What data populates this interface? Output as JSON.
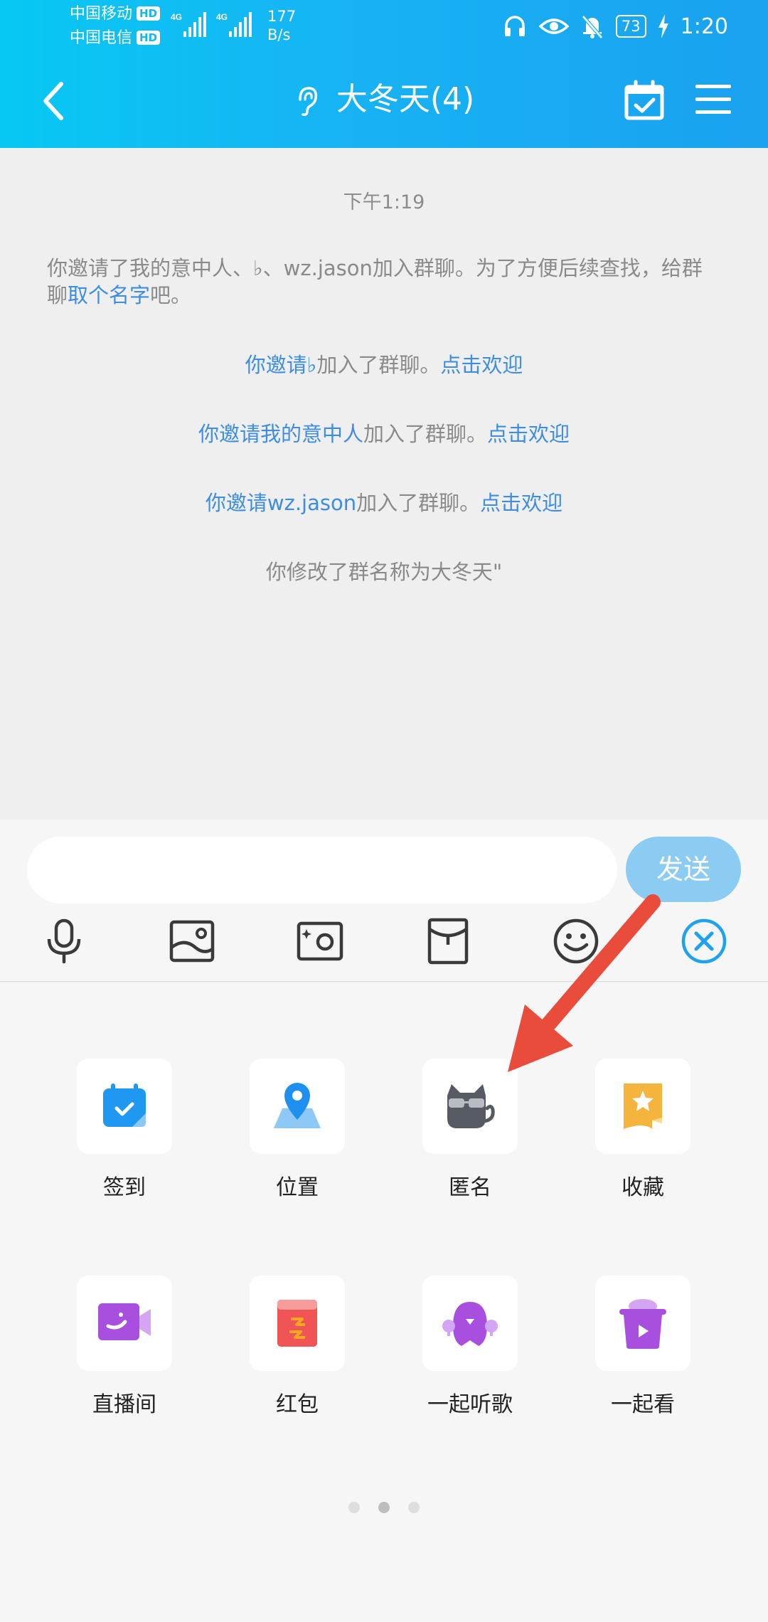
{
  "status": {
    "carrier1": "中国移动",
    "carrier2": "中国电信",
    "hd": "HD",
    "net": "4G",
    "speed_value": "177",
    "speed_unit": "B/s",
    "battery": "73",
    "time": "1:20"
  },
  "header": {
    "title": "大冬天(4)",
    "icons": [
      "back-icon",
      "ear-icon",
      "calendar-check-icon",
      "menu-icon"
    ]
  },
  "chat": {
    "timestamp": "下午1:19",
    "msg1": {
      "line1": "你邀请了我的意中人、♭、wz.jason加入群聊。为了方便后续查找，给群",
      "line2_prefix": "聊",
      "line2_link": "取个名字",
      "line2_suffix": "吧。"
    },
    "msg2": {
      "you": "你邀请",
      "name": "♭",
      "text": "加入了群聊。",
      "link": "点击欢迎"
    },
    "msg3": {
      "you": "你邀请",
      "name": "我的意中人",
      "text": "加入了群聊。",
      "link": "点击欢迎"
    },
    "msg4": {
      "you": "你邀请",
      "name": "wz.jason",
      "text": "加入了群聊。",
      "link": "点击欢迎"
    },
    "msg5": "你修改了群名称为大冬天\""
  },
  "input": {
    "value": "",
    "send_label": "发送",
    "tools": [
      "mic-icon",
      "image-icon",
      "camera-icon",
      "red-envelope-icon",
      "emoji-icon",
      "close-circle-icon"
    ]
  },
  "panel": {
    "apps": [
      {
        "label": "签到",
        "icon": "checkin-calendar-icon"
      },
      {
        "label": "位置",
        "icon": "location-pin-icon"
      },
      {
        "label": "匿名",
        "icon": "anonymous-cat-icon"
      },
      {
        "label": "收藏",
        "icon": "favorite-bookmark-icon"
      },
      {
        "label": "直播间",
        "icon": "live-video-icon"
      },
      {
        "label": "红包",
        "icon": "red-packet-icon"
      },
      {
        "label": "一起听歌",
        "icon": "listen-together-icon"
      },
      {
        "label": "一起看",
        "icon": "watch-together-icon"
      }
    ],
    "page_count": 3,
    "active_page": 2
  },
  "colors": {
    "header_start": "#07c8f3",
    "header_end": "#1aa1ef",
    "link": "#3d8de3",
    "send_button": "#8ccbf2",
    "annotation_arrow": "#ea4c3c"
  }
}
